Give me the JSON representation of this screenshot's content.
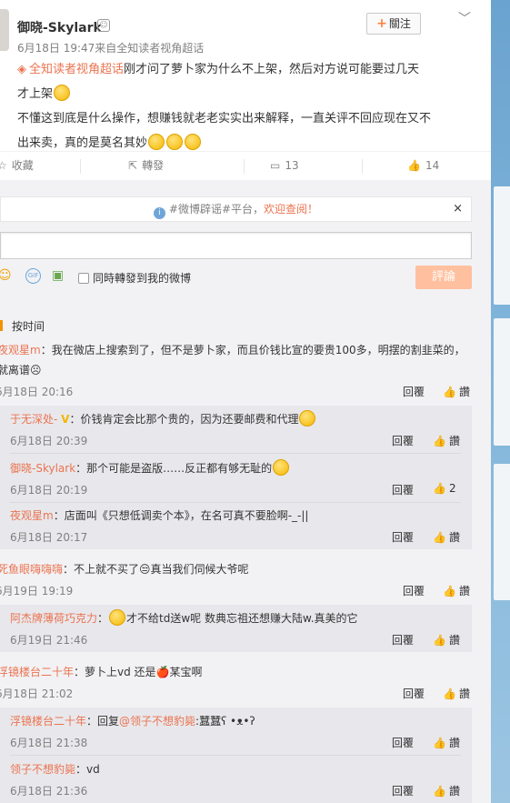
{
  "post": {
    "username": "御晓-Skylark",
    "vip_mark": "☺",
    "meta": "6月18日 19:47来自全知读者视角超话",
    "follow_label": "關注",
    "topic_link": "全知读者视角超话",
    "text_1": "刚才问了萝卜家为什么不上架，然后对方说可能要过几天",
    "text_2": "才上架",
    "text_3": "不懂这到底是什么操作，想赚钱就老老实实出来解释，一直关评不回应现在又不",
    "text_4": "出来卖，真的是莫名其妙"
  },
  "actions": {
    "favorite": "收藏",
    "repost": "轉發",
    "comment_count": "13",
    "like_count": "14"
  },
  "notice": {
    "prefix": "#微博辟谣#平台，",
    "highlight": "欢迎查阅！",
    "close": "×"
  },
  "composer": {
    "repost_label": "同時轉發到我的微博",
    "submit_label": "評論",
    "gif_label": "GIF"
  },
  "sort_label": "按时间",
  "ui": {
    "reply": "回覆",
    "like": "讚"
  },
  "comments": [
    {
      "user": "夜观星m",
      "text_1": "：我在微店上搜索到了，但不是萝卜家，而且价钱比宣的要贵100多，明摆的割韭菜的，",
      "text_2": "就离谱☹",
      "time": "6月18日 20:16",
      "replies": [
        {
          "user": "于无深处-",
          "badge": "V",
          "text": "：价钱肯定会比那个贵的，因为还要邮费和代理",
          "time": "6月18日 20:39",
          "likes": ""
        },
        {
          "user": "御晓-Skylark",
          "text": "：那个可能是盗版……反正都有够无耻的",
          "time": "6月18日 20:19",
          "likes": "2"
        },
        {
          "user": "夜观星m",
          "text": "：店面叫《只想低调卖个本》，在名可真不要脸啊-_-||",
          "time": "6月18日 20:17",
          "likes": ""
        }
      ]
    },
    {
      "user": "死鱼眼嗨嗨嗨",
      "text_1": "：不上就不买了😒真当我们伺候大爷呢",
      "time": "6月19日 19:19",
      "replies": [
        {
          "user": "阿杰牌薄荷巧克力",
          "text": "：",
          "text_b": "才不给td送w呢 数典忘祖还想赚大陆w.真美的它",
          "time": "6月19日 21:46",
          "likes": ""
        }
      ]
    },
    {
      "user": "浮镜楼台二十年",
      "text_1": "：萝卜上vd 还是🍎某宝啊",
      "time": "6月18日 21:02",
      "replies": [
        {
          "user": "浮镜楼台二十年",
          "text": "：回复",
          "mention": "@领子不想豹毙",
          "text_b": ":蠶蠶ʕ •ᴥ•ʔ",
          "time": "6月18日 21:38",
          "likes": ""
        },
        {
          "user": "领子不想豹毙",
          "text": "：vd",
          "time": "6月18日 21:36",
          "likes": ""
        }
      ]
    }
  ]
}
